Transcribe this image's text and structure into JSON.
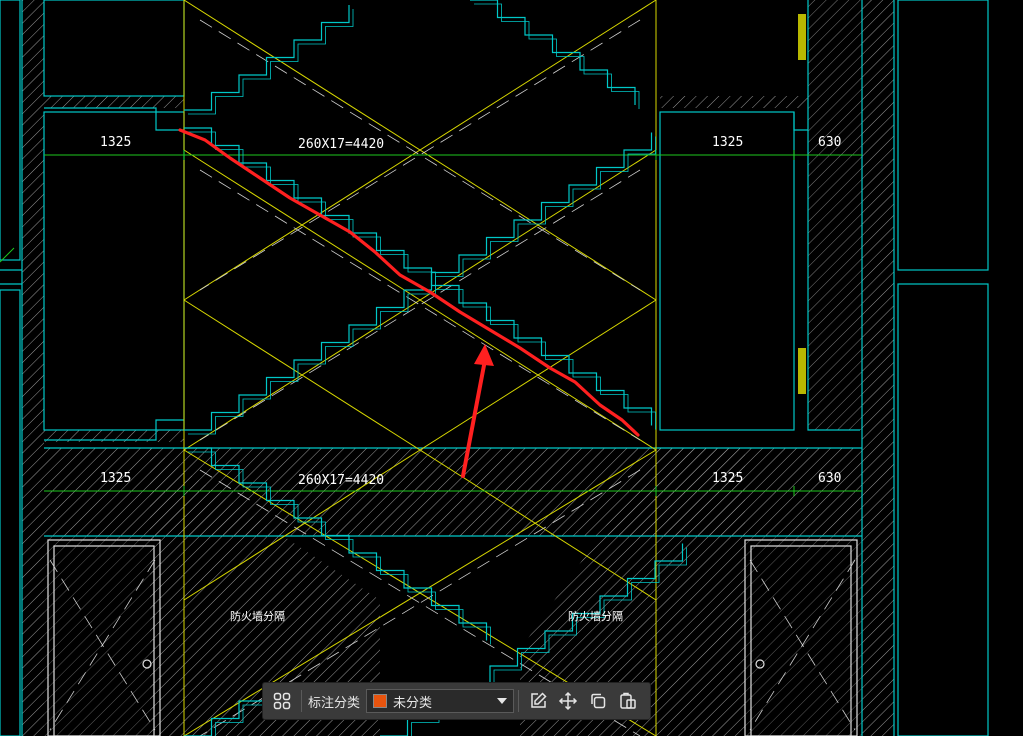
{
  "drawing": {
    "dimension_labels": {
      "top_left_width": "1325",
      "top_run": "260X17=4420",
      "top_right_width": "1325",
      "top_right_extra": "630",
      "bottom_left_width": "1325",
      "bottom_run": "260X17=4420",
      "bottom_right_width": "1325",
      "bottom_right_extra": "630"
    },
    "notes": {
      "left_firewall": "防火墙分隔",
      "right_firewall": "防火墙分隔"
    },
    "colors": {
      "wall_cyan": "#00c8c8",
      "grid_yellow": "#d8d800",
      "dim_green": "#1ec81e",
      "markup_red": "#ff2020",
      "hatch_white": "#bfbfbf"
    }
  },
  "toolbar": {
    "layout_icon": "grid-icon",
    "category_label": "标注分类",
    "category_value": "未分类",
    "category_color": "#e8540e",
    "buttons": [
      "edit-icon",
      "move-icon",
      "copy-icon",
      "paste-icon"
    ]
  }
}
